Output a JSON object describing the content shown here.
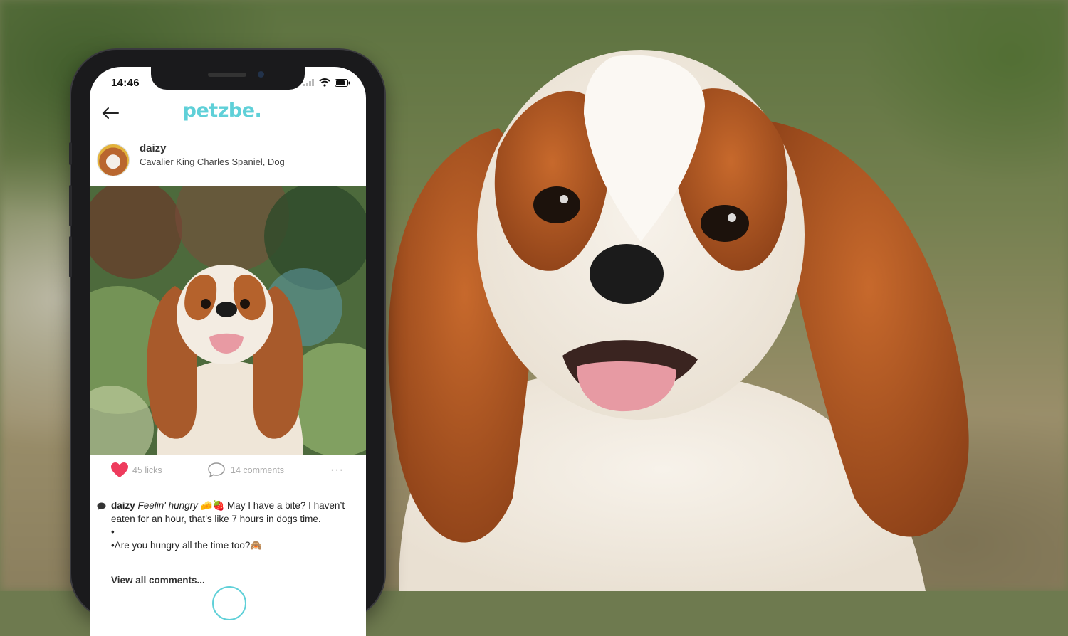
{
  "status_bar": {
    "time": "14:46"
  },
  "app": {
    "logo_text": "petzbe."
  },
  "post": {
    "username": "daizy",
    "breed": "Cavalier King Charles Spaniel, Dog",
    "likes_label": "45 licks",
    "comments_label": "14 comments",
    "more_label": "···",
    "caption": {
      "username": "daizy",
      "italic": "Feelin' hungry",
      "emoji_1": "🧀🍓",
      "text_1": " May I have a bite? I haven’t eaten for an hour, that’s like 7 hours in dogs time.",
      "bullet_line": "•",
      "line_3": "•Are you hungry all the time too?",
      "emoji_2": "🙈"
    },
    "view_all_comments": "View all comments..."
  },
  "colors": {
    "brand": "#5fd0d8",
    "like": "#ee3b5d",
    "muted_text": "#aaaaaa"
  },
  "icons": {
    "back": "arrow-left-icon",
    "heart": "heart-icon",
    "comment": "speech-bubble-icon",
    "more": "ellipsis-icon",
    "wifi": "wifi-icon",
    "battery": "battery-icon",
    "signal": "signal-icon"
  }
}
